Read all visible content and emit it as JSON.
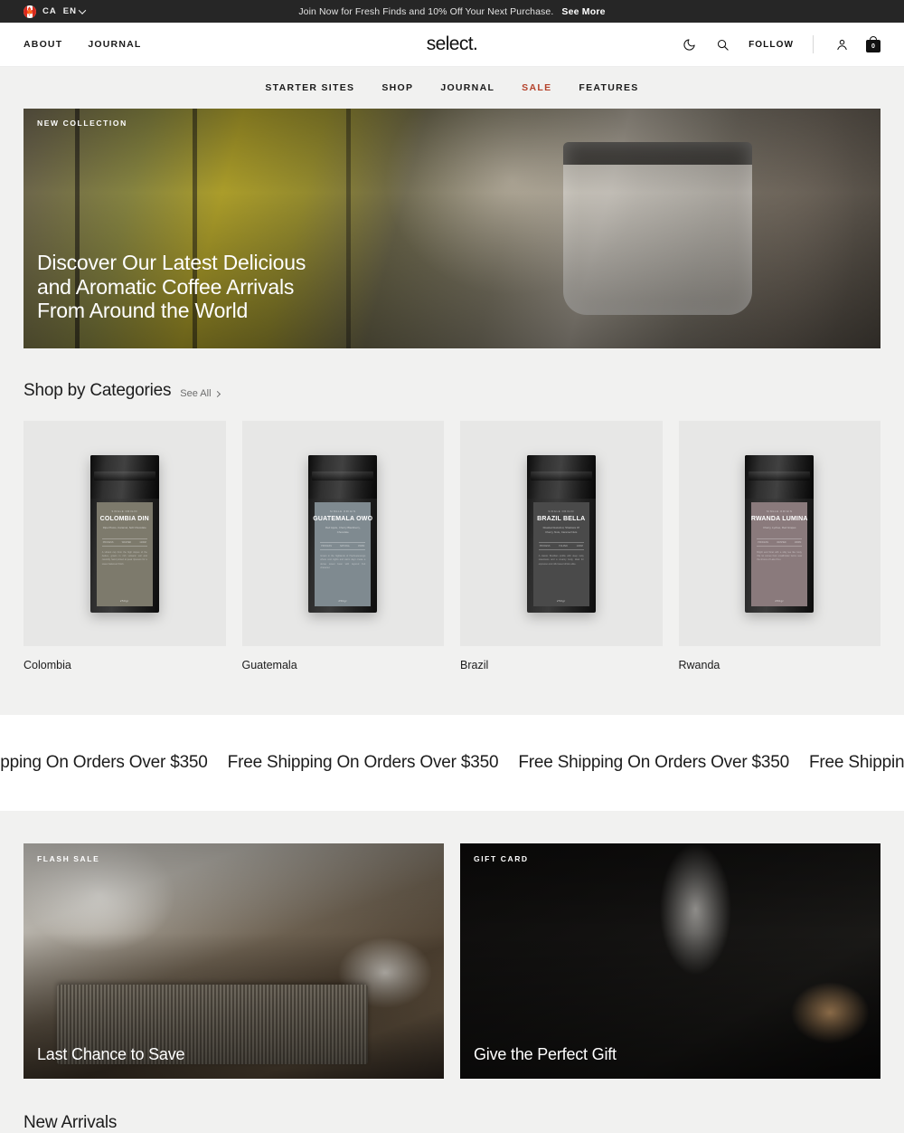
{
  "announcement": {
    "country_code": "CA",
    "language": "EN",
    "message": "Join Now for Fresh Finds and 10% Off Your Next Purchase.",
    "cta": "See More"
  },
  "header": {
    "links": [
      {
        "label": "ABOUT"
      },
      {
        "label": "JOURNAL"
      }
    ],
    "brand": "select.",
    "follow_label": "FOLLOW",
    "cart_count": "0",
    "icons": [
      "moon-icon",
      "search-icon",
      "account-icon",
      "cart-icon"
    ]
  },
  "mainnav": {
    "items": [
      {
        "label": "STARTER SITES",
        "accent": false
      },
      {
        "label": "SHOP",
        "accent": false
      },
      {
        "label": "JOURNAL",
        "accent": false
      },
      {
        "label": "SALE",
        "accent": true
      },
      {
        "label": "FEATURES",
        "accent": false
      }
    ],
    "accent_color": "#b5432c"
  },
  "hero": {
    "eyebrow": "NEW COLLECTION",
    "title_line1": "Discover Our Latest Delicious",
    "title_line2": "and Aromatic Coffee Arrivals",
    "title_line3": "From Around the World"
  },
  "categories": {
    "title": "Shop by Categories",
    "see_all": "See All",
    "items": [
      {
        "name": "Colombia",
        "pack": {
          "sup": "SINGLE ORIGIN",
          "title": "COLOMBIA DIN",
          "desc": "Ripe Plums, Caramel,\nSoft Chocolate",
          "specs": [
            "PROCESS",
            "WASHED",
            "1200M"
          ],
          "body": "A vibrant cup from the high slopes of the Andes, grown in rich volcanic soil and carefully hand picked at peak ripeness for a sweet balanced finish.",
          "weight": "250gr",
          "label_color": "#7d7a6c"
        }
      },
      {
        "name": "Guatemala",
        "pack": {
          "sup": "SINGLE ORIGIN",
          "title": "GUATEMALA OWO",
          "desc": "Red Apple, Cherry Blackberry,\nChocolate",
          "specs": [
            "PROCESS",
            "NATURAL",
            "1500M"
          ],
          "body": "Grown in the highlands of Huehuetenango where cool nights and warm days create a dense sweet bean with layered fruit character.",
          "weight": "250gr",
          "label_color": "#7f8a90"
        }
      },
      {
        "name": "Brazil",
        "pack": {
          "sup": "SINGLE ORIGIN",
          "title": "BRAZIL BELLA",
          "desc": "Roasted Hazelnut, Shadows Of\nCherry, Nuts, Caramel Nuts",
          "specs": [
            "PROCESS",
            "PULPED",
            "1100M"
          ],
          "body": "A classic Brazilian profile with deep nutty sweetness and a creamy body, ideal for espresso and milk based drinks alike.",
          "weight": "250gr",
          "label_color": "#4a4a4a"
        }
      },
      {
        "name": "Rwanda",
        "pack": {
          "sup": "SINGLE ORIGIN",
          "title": "RWANDA LUMINA",
          "desc": "Cherry, Lychee, Red Grapes",
          "specs": [
            "PROCESS",
            "WASHED",
            "1800M"
          ],
          "body": "Bright and floral with a silky tea like body, this lot comes from smallholder farms near the shores of Lake Kivu.",
          "weight": "250gr",
          "label_color": "#8a7a7c"
        }
      }
    ]
  },
  "marquee": {
    "text": "Free Shipping On Orders Over $350",
    "repeats": 6
  },
  "promos": [
    {
      "eyebrow": "FLASH SALE",
      "title": "Last Chance to Save"
    },
    {
      "eyebrow": "GIFT CARD",
      "title": "Give the Perfect Gift"
    }
  ],
  "new_arrivals": {
    "title": "New Arrivals"
  }
}
